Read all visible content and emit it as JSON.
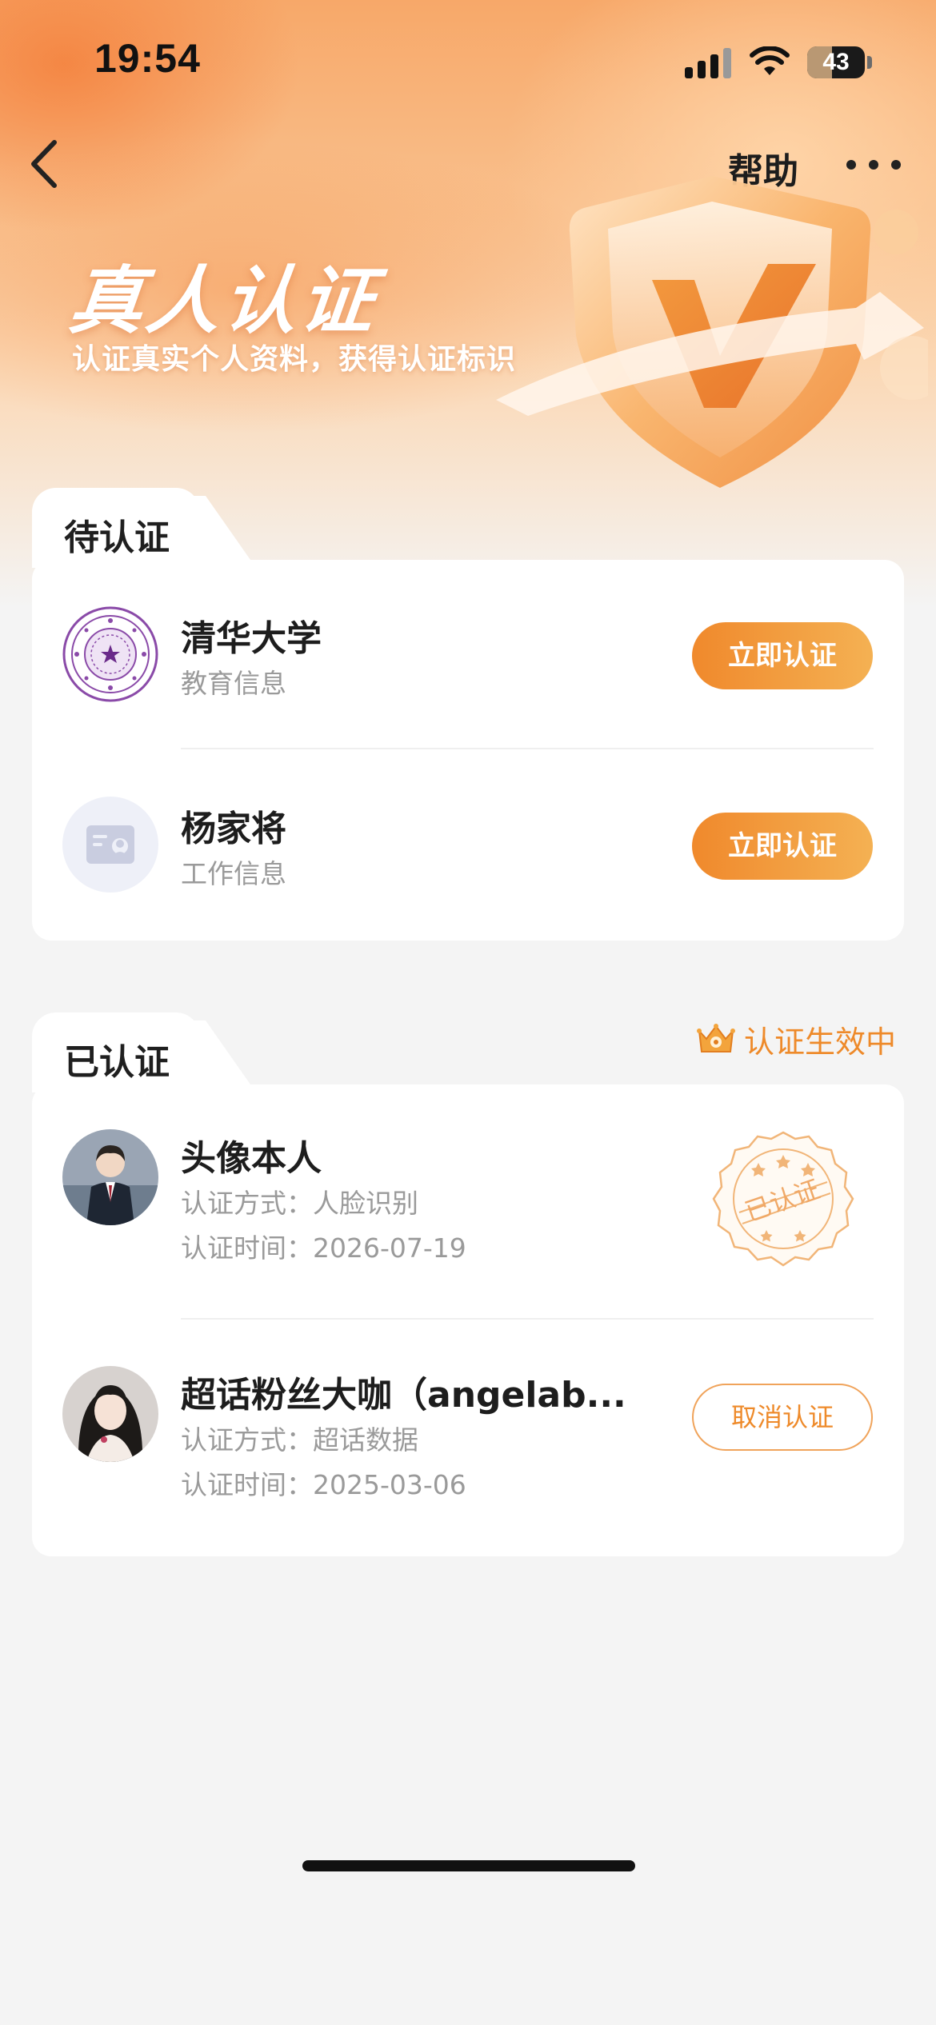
{
  "status_bar": {
    "time": "19:54",
    "battery": "43",
    "battery_fraction": 0.43
  },
  "nav": {
    "back_icon": "chevron-left-icon",
    "help_label": "帮助",
    "more_icon": "ellipsis-icon"
  },
  "hero": {
    "title": "真人认证",
    "subtitle": "认证真实个人资料，获得认证标识",
    "illustration": "shield-check-icon"
  },
  "pending": {
    "tab_label": "待认证",
    "items": [
      {
        "title": "清华大学",
        "subtitle": "教育信息",
        "button": "立即认证",
        "icon": "university-seal-icon"
      },
      {
        "title": "杨家将",
        "subtitle": "工作信息",
        "button": "立即认证",
        "icon": "id-card-icon"
      }
    ]
  },
  "verified": {
    "tab_label": "已认证",
    "effect_label": "认证生效中",
    "effect_icon": "crown-icon",
    "items": [
      {
        "title": "头像本人",
        "method": "认证方式：人脸识别",
        "time": "认证时间：2026-07-19",
        "stamp": "已认证"
      },
      {
        "title": "超话粉丝大咖（angelab...",
        "method": "认证方式：超话数据",
        "time": "认证时间：2025-03-06",
        "button": "取消认证"
      }
    ]
  },
  "colors": {
    "accent": "#ee8a2a",
    "button_gradient_start": "#f0892c",
    "button_gradient_end": "#f4b153",
    "university_purple": "#7a3a9a"
  }
}
